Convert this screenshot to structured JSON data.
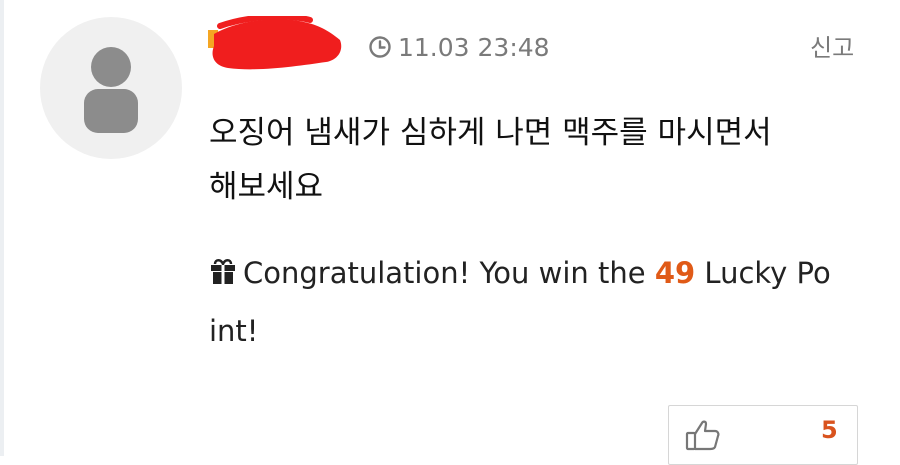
{
  "comment": {
    "timestamp": "11.03 23:48",
    "report_label": "신고",
    "body_lines": [
      "오징어 냄새가 심하게 나면 맥주를 마시면서",
      "해보세요"
    ],
    "reward": {
      "text_before": "Congratulation! You win the ",
      "points": "49",
      "line1_after": " Lucky Po",
      "line2": "int!"
    },
    "like_count": "5"
  },
  "colors": {
    "redaction": "#f01e1e",
    "points_accent": "#e05a17",
    "like_count": "#d9531e",
    "meta_text": "#7a7a7a"
  },
  "icons": {
    "avatar": "default-user-icon",
    "clock": "clock-icon",
    "gift": "gift-icon",
    "like": "thumbs-up-icon"
  }
}
